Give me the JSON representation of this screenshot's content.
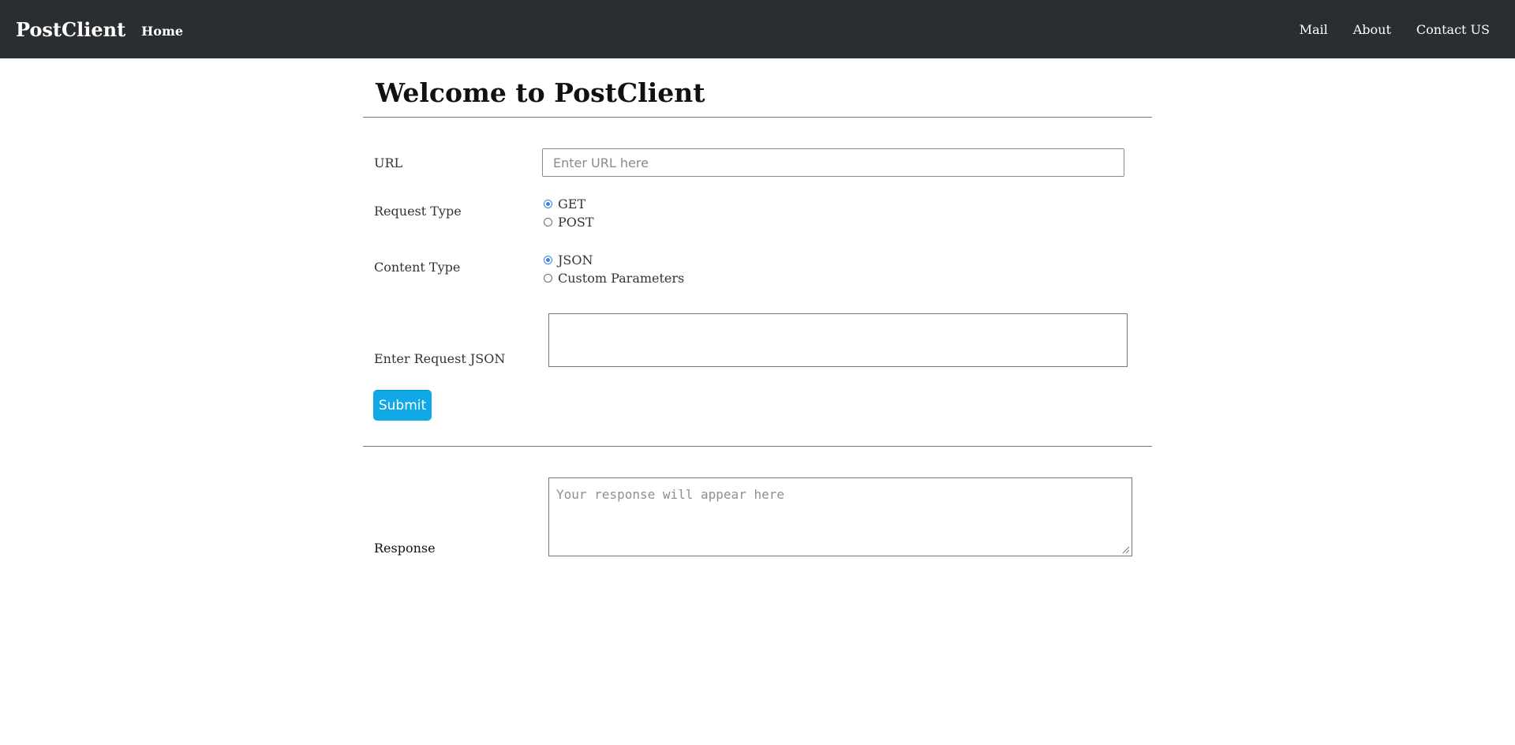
{
  "navbar": {
    "brand": "PostClient",
    "home": "Home",
    "links": [
      "Mail",
      "About",
      "Contact US"
    ]
  },
  "page": {
    "title": "Welcome to PostClient"
  },
  "form": {
    "url_label": "URL",
    "url_placeholder": "Enter URL here",
    "url_value": "",
    "request_type_label": "Request Type",
    "request_types": [
      {
        "label": "GET",
        "checked": true
      },
      {
        "label": "POST",
        "checked": false
      }
    ],
    "content_type_label": "Content Type",
    "content_types": [
      {
        "label": "JSON",
        "checked": true
      },
      {
        "label": "Custom Parameters",
        "checked": false
      }
    ],
    "request_json_label": "Enter Request JSON",
    "request_json_value": "",
    "submit_label": "Submit"
  },
  "response": {
    "label": "Response",
    "placeholder": "Your response will appear here"
  },
  "colors": {
    "navbar_bg": "#2b2e31",
    "submit_bg": "#10a8e6",
    "radio_accent": "#3c82e6"
  }
}
